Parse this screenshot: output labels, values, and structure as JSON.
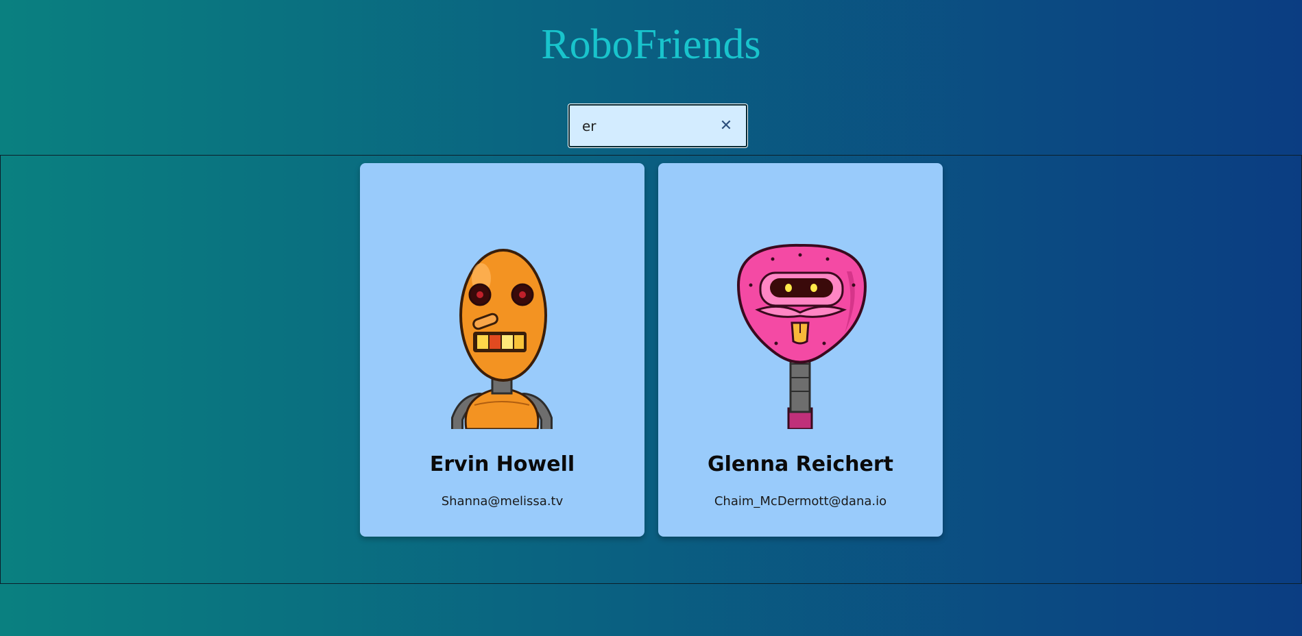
{
  "app": {
    "title": "RoboFriends"
  },
  "search": {
    "value": "er",
    "clear_icon": "close-icon"
  },
  "robots": [
    {
      "name": "Ervin Howell",
      "email": "Shanna@melissa.tv",
      "color": "#f39322"
    },
    {
      "name": "Glenna Reichert",
      "email": "Chaim_McDermott@dana.io",
      "color": "#f44aa4"
    }
  ]
}
